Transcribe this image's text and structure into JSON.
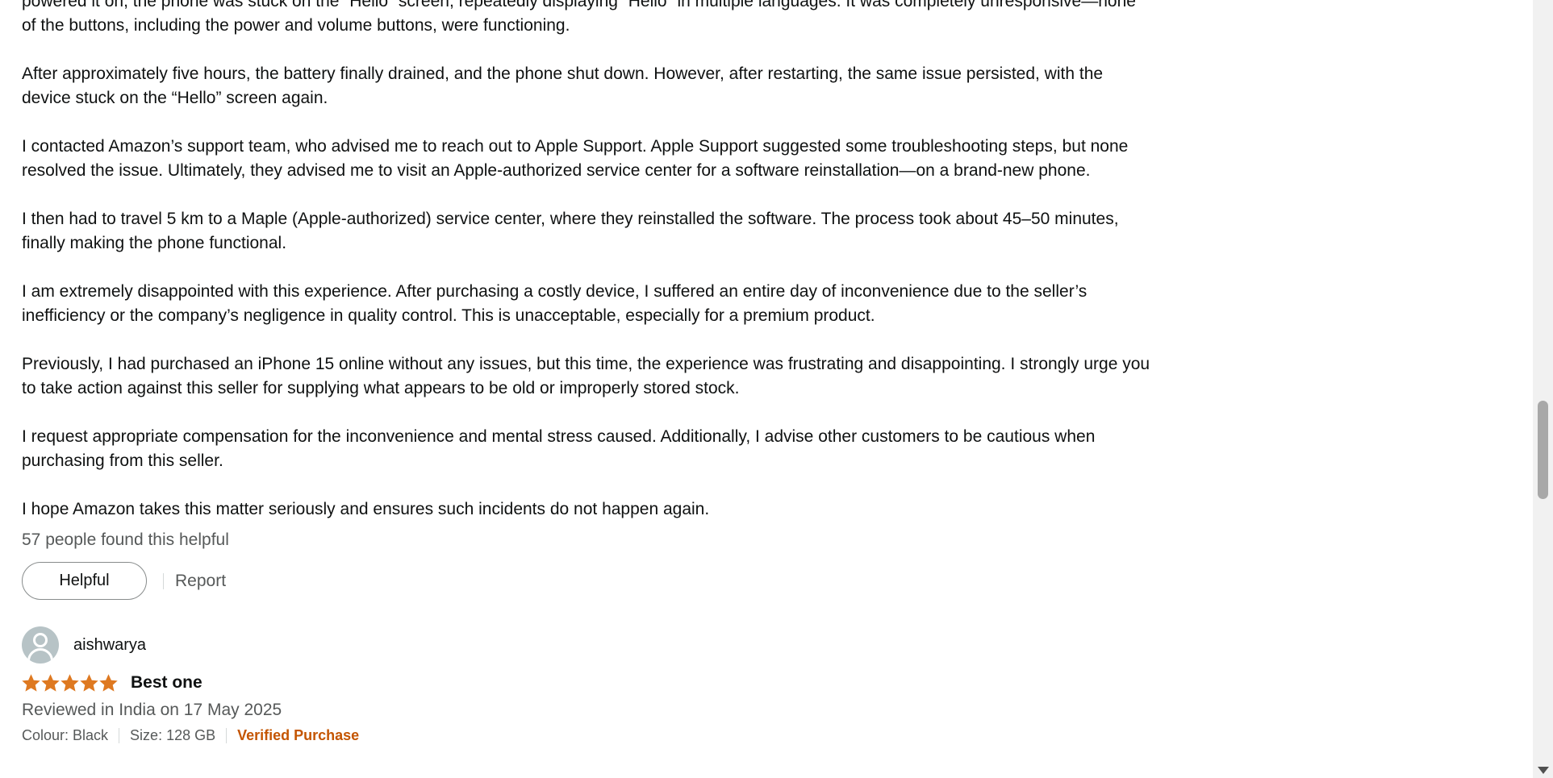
{
  "review1": {
    "paragraphs": [
      "powered it on, the phone was stuck on the “Hello” screen, repeatedly displaying “Hello” in multiple languages. It was completely unresponsive—none of the buttons, including the power and volume buttons, were functioning.",
      "After approximately five hours, the battery finally drained, and the phone shut down. However, after restarting, the same issue persisted, with the device stuck on the “Hello” screen again.",
      "I contacted Amazon’s support team, who advised me to reach out to Apple Support. Apple Support suggested some troubleshooting steps, but none resolved the issue. Ultimately, they advised me to visit an Apple-authorized service center for a software reinstallation—on a brand-new phone.",
      "I then had to travel 5 km to a Maple (Apple-authorized) service center, where they reinstalled the software. The process took about 45–50 minutes, finally making the phone functional.",
      "I am extremely disappointed with this experience. After purchasing a costly device, I suffered an entire day of inconvenience due to the seller’s inefficiency or the company’s negligence in quality control. This is unacceptable, especially for a premium product.",
      "Previously, I had purchased an iPhone 15 online without any issues, but this time, the experience was frustrating and disappointing. I strongly urge you to take action against this seller for supplying what appears to be old or improperly stored stock.",
      "I request appropriate compensation for the inconvenience and mental stress caused. Additionally, I advise other customers to be cautious when purchasing from this seller.",
      "I hope Amazon takes this matter seriously and ensures such incidents do not happen again."
    ],
    "helpful_count": "57 people found this helpful",
    "helpful_label": "Helpful",
    "report_label": "Report"
  },
  "review2": {
    "reviewer": "aishwarya",
    "stars": 5,
    "star_color": "#de7921",
    "title": "Best one",
    "date": "Reviewed in India on 17 May 2025",
    "colour": "Colour: Black",
    "size": "Size: 128 GB",
    "verified": "Verified Purchase",
    "verified_color": "#c45500"
  }
}
